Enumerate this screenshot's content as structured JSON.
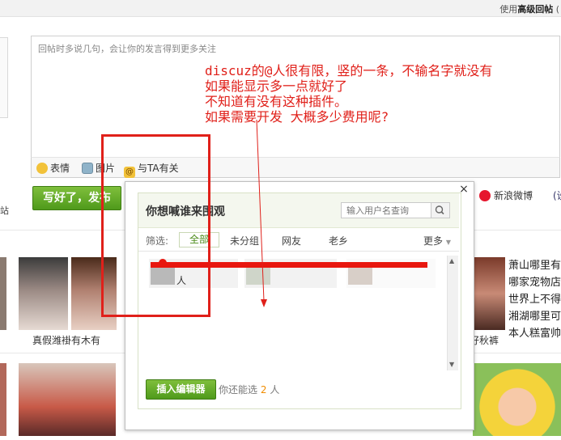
{
  "topbar": {
    "use_prefix": "使用",
    "use_link": "高级回帖",
    "use_suffix": "("
  },
  "editor": {
    "placeholder": "回帖时多说几句，会让你的发言得到更多关注"
  },
  "toolbar": {
    "emoji_label": "表情",
    "image_label": "图片",
    "mention_label": "与TA有关"
  },
  "submit": {
    "label": "写好了，发布"
  },
  "weibo": {
    "label": "新浪微博"
  },
  "fragments": {
    "right_edge": "(设",
    "left_edge": "站"
  },
  "background": {
    "row1_captions": [
      "真假潍褂有木有",
      "好秋裤"
    ],
    "right_lines": [
      "萧山哪里有",
      "哪家宠物店",
      "世界上不得",
      "湘湖哪里可",
      "本人糕富帅"
    ]
  },
  "popup": {
    "title": "你想喊谁来围观",
    "search_placeholder": "输入用户名查询",
    "filter_label": "筛选:",
    "tabs": [
      "全部",
      "未分组",
      "网友",
      "老乡"
    ],
    "more_label": "更多",
    "friends": [
      {
        "name": "人"
      },
      {
        "name": ""
      },
      {
        "name": ""
      }
    ],
    "insert_label": "插入编辑器",
    "remain_prefix": "你还能选",
    "remain_count": "2",
    "remain_suffix": "人"
  },
  "annotation": {
    "lines": [
      "discuz的@人很有限，竖的一条，不输名字就没有",
      "如果能显示多一点就好了",
      "不知道有没有这种插件。",
      "如果需要开发 大概多少费用呢?"
    ],
    "color": "#e0201a"
  }
}
